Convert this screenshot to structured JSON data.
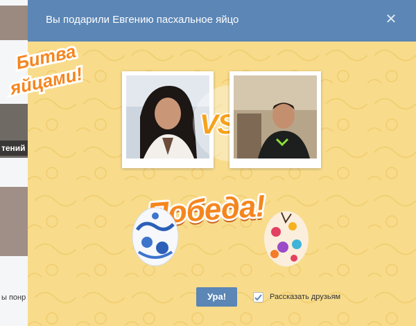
{
  "background": {
    "friend_name_fragment": "тений",
    "like_text_fragment": "ы понр",
    "promo_text_line1": "Битва",
    "promo_text_line2": "яйцами!"
  },
  "modal": {
    "title": "Вы подарили Евгению пасхальное яйцо",
    "close_symbol": "✕",
    "vs_text": "VS",
    "result_text": "Победа!",
    "ok_button_label": "Ура!",
    "share_checkbox_label": "Рассказать друзьям",
    "share_checked": true
  },
  "colors": {
    "header": "#5b86b5",
    "modal_bg": "#f8dc8c",
    "accent_orange": "#f5861f",
    "button": "#5b86b5"
  }
}
